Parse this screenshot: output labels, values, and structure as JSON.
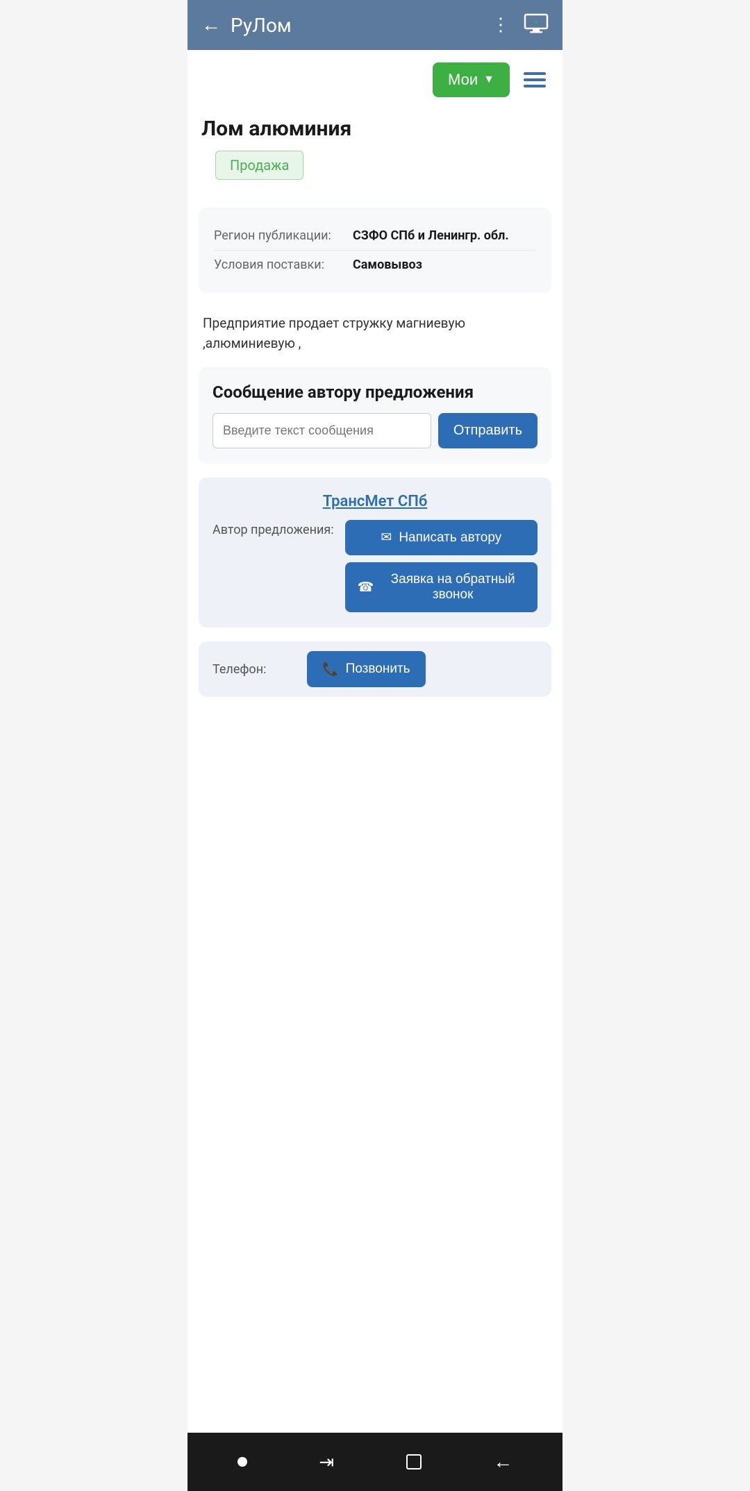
{
  "header": {
    "back_label": "←",
    "title": "РуЛом",
    "dots": "⋮",
    "monitor_aria": "monitor-icon"
  },
  "topbar": {
    "moi_label": "Мои",
    "moi_chevron": "▼",
    "hamburger_aria": "menu"
  },
  "page": {
    "title": "Лом алюминия"
  },
  "sale_tag": {
    "label": "Продажа"
  },
  "info_card": {
    "rows": [
      {
        "label": "Регион публикации:",
        "value": "СЗФО СПб и Ленингр. обл."
      },
      {
        "label": "Условия поставки:",
        "value": "Самовывоз"
      }
    ]
  },
  "description": {
    "text": "Предприятие продает стружку магниевую ,алюминиевую ,"
  },
  "message_section": {
    "title": "Сообщение автору предложения",
    "input_placeholder": "Введите текст сообщения",
    "send_label": "Отправить"
  },
  "author_section": {
    "company_name": "ТрансМет СПб",
    "author_label": "Автор предложения:",
    "write_btn": "Написать автору",
    "callback_btn": "Заявка на обратный звонок"
  },
  "phone_section": {
    "label": "Телефон:",
    "call_btn": "Позвонить"
  },
  "bottom_nav": {
    "circle_aria": "home",
    "tabs_aria": "recent-apps",
    "square_aria": "overview",
    "back_aria": "back"
  }
}
